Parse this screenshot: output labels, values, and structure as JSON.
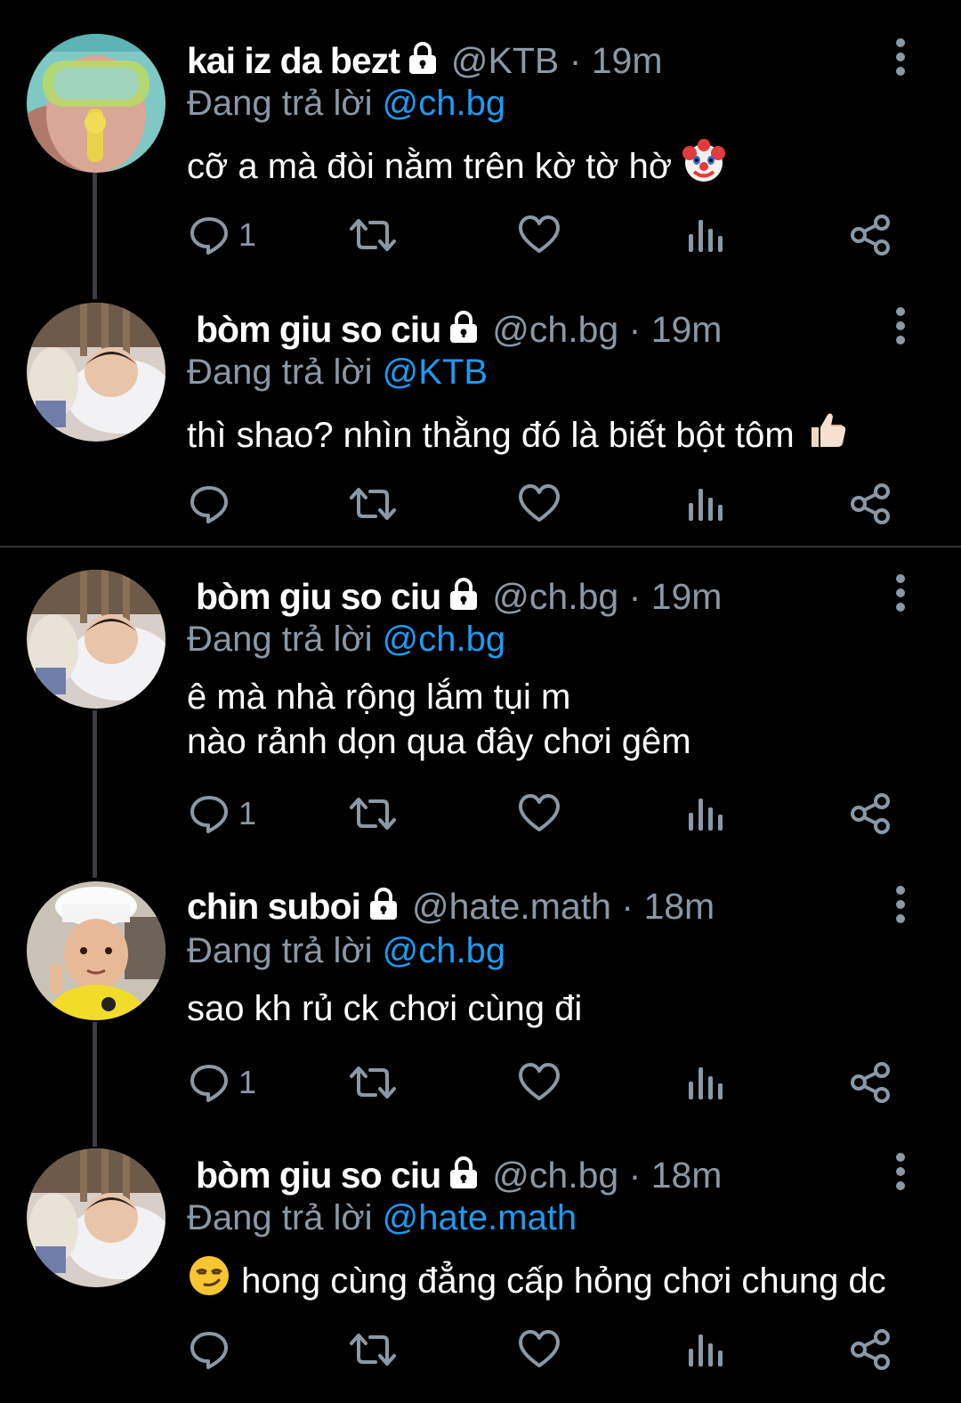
{
  "reply_prefix": "Đang trả lời",
  "tweets": [
    {
      "name": "kai iz da bezt",
      "handle": "@KTB",
      "dot": "·",
      "time": "19m",
      "reply_to": "@ch.bg",
      "text_lines": [
        "cỡ a mà đòi nằm trên kờ tờ hờ"
      ],
      "trailing_emoji": "clown-face",
      "reply_count": "1",
      "avatar": "snorkel-mask-child"
    },
    {
      "name": "bòm giu so ciu",
      "handle": "@ch.bg",
      "dot": "·",
      "time": "19m",
      "reply_to": "@KTB",
      "text_lines": [
        "thì shao? nhìn thằng đó là biết bột tôm"
      ],
      "trailing_emoji": "thumbs-up",
      "reply_count": "",
      "avatar": "sleeping-child"
    },
    {
      "name": "bòm giu so ciu",
      "handle": "@ch.bg",
      "dot": "·",
      "time": "19m",
      "reply_to": "@ch.bg",
      "text_lines": [
        "ê mà nhà rộng lắm tụi m",
        "nào rảnh dọn qua đây chơi gêm"
      ],
      "trailing_emoji": "",
      "reply_count": "1",
      "avatar": "sleeping-child"
    },
    {
      "name": "chin suboi",
      "handle": "@hate.math",
      "dot": "·",
      "time": "18m",
      "reply_to": "@ch.bg",
      "text_lines": [
        "sao kh rủ ck chơi cùng đi"
      ],
      "trailing_emoji": "",
      "reply_count": "1",
      "avatar": "chef-hat-child"
    },
    {
      "name": "bòm giu so ciu",
      "handle": "@ch.bg",
      "dot": "·",
      "time": "18m",
      "reply_to": "@hate.math",
      "text_lines": [
        "hong cùng đẳng cấp hỏng chơi chung dc"
      ],
      "leading_emoji": "smirking-face",
      "reply_count": "",
      "avatar": "sleeping-child"
    }
  ],
  "icons": {
    "lock": "lock-icon",
    "reply": "reply-icon",
    "retweet": "retweet-icon",
    "like": "like-icon",
    "views": "views-icon",
    "share": "share-icon",
    "more": "more-icon"
  },
  "colors": {
    "background": "#000000",
    "name": "#ffffff",
    "muted": "#8b98a5",
    "mention": "#1d9bf0",
    "divider": "#2f3336",
    "thread_line": "#3a3d41"
  }
}
